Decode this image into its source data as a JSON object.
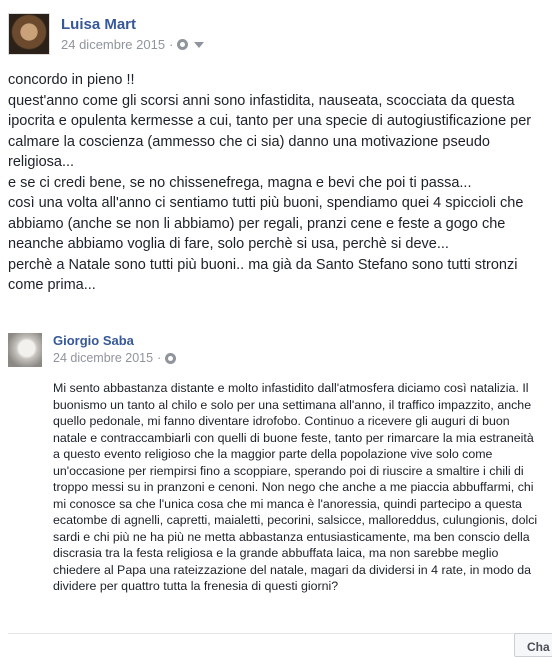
{
  "post": {
    "author": "Luisa Mart",
    "date": "24 dicembre 2015",
    "separator": "·",
    "paragraphs": [
      "concordo in pieno !!",
      "quest'anno come gli scorsi anni sono infastidita, nauseata, scocciata da questa ipocrita e opulenta kermesse a cui, tanto per una specie di autogiustificazione per calmare la coscienza (ammesso che ci sia) danno una motivazione pseudo religiosa...",
      "e se ci credi bene, se no chissenefrega, magna e bevi che poi ti passa...",
      "così una volta all'anno ci sentiamo tutti più buoni, spendiamo quei 4 spiccioli che abbiamo (anche se non li abbiamo) per regali, pranzi cene e feste a gogo che neanche abbiamo voglia di fare, solo perchè si usa, perchè si deve...",
      "perchè a Natale sono tutti più buoni.. ma già da Santo Stefano sono tutti stronzi come prima..."
    ]
  },
  "reply": {
    "author": "Giorgio Saba",
    "date": "24 dicembre 2015",
    "separator": "·",
    "text": "Mi sento abbastanza distante e molto infastidito dall'atmosfera diciamo così natalizia. Il buonismo un tanto al chilo e solo per una settimana all'anno, il traffico impazzito, anche quello pedonale, mi fanno diventare idrofobo. Continuo a ricevere gli auguri di buon natale e contraccambiarli con quelli di buone feste, tanto per rimarcare la mia estraneità a questo evento religioso che la maggior parte della popolazione vive solo come un'occasione per riempirsi fino a scoppiare, sperando poi di riuscire a smaltire i chili di troppo messi su in pranzoni e cenoni. Non nego che anche a me piaccia abbuffarmi, chi mi conosce sa che l'unica cosa che mi manca è l'anoressia, quindi partecipo a questa ecatombe di agnelli, capretti, maialetti, pecorini, salsicce, malloreddus, culungionis, dolci sardi e chi più ne ha più ne metta abbastanza entusiasticamente, ma ben conscio della discrasia tra la festa religiosa e la grande abbuffata laica, ma non sarebbe meglio chiedere al Papa una rateizzazione del natale, magari da dividersi in 4 rate, in modo da dividere per quattro tutta la frenesia di questi giorni?"
  },
  "footer": {
    "button_label": "Cha"
  }
}
